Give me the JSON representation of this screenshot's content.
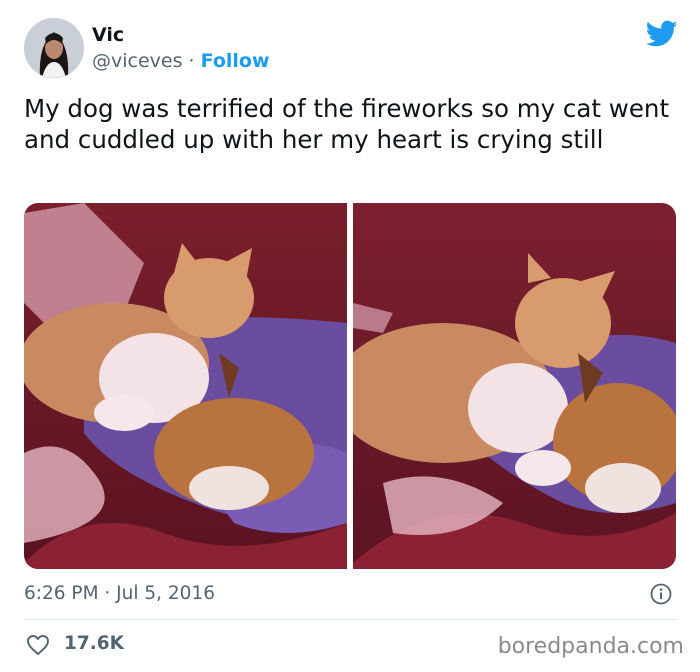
{
  "tweet": {
    "author": {
      "name": "Vic",
      "handle": "@viceves",
      "separator": " · ",
      "follow_label": "Follow"
    },
    "text": "My dog was terrified of the fireworks so my cat went and cuddled up with her my heart is crying still",
    "timestamp": "6:26 PM · Jul 5, 2016",
    "likes": "17.6K",
    "media_count": 2
  },
  "icons": {
    "platform": "twitter-bird-icon",
    "info": "info-icon",
    "like": "heart-icon"
  },
  "colors": {
    "accent": "#1d9bf0",
    "text": "#0f1419",
    "muted": "#536471"
  },
  "watermark": "boredpanda.com"
}
